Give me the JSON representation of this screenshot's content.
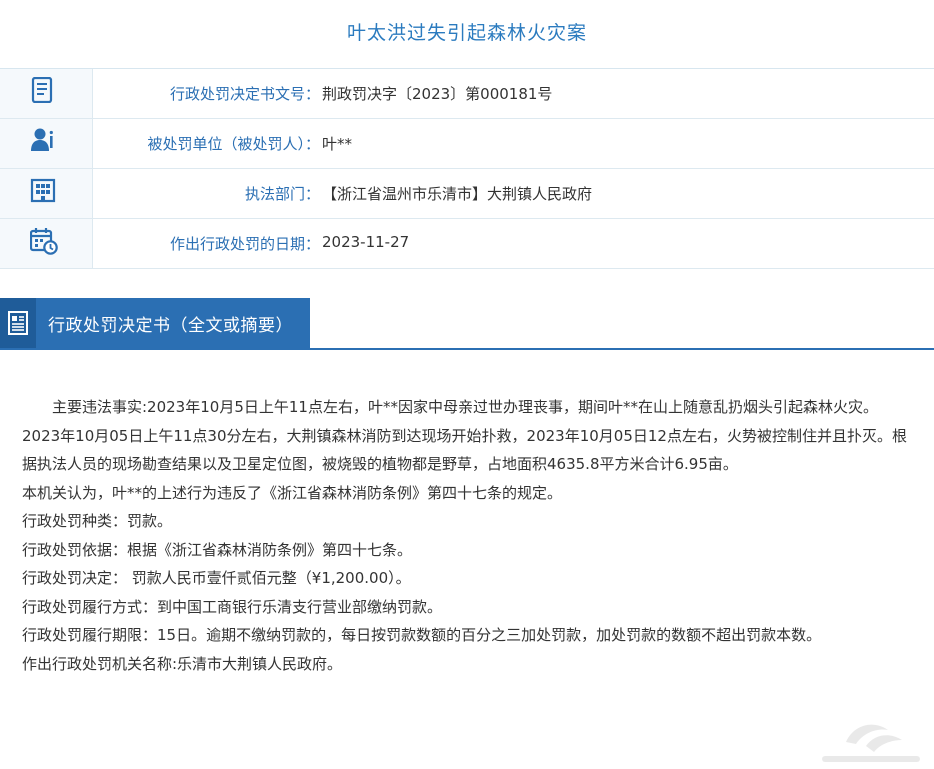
{
  "page_title": "叶太洪过失引起森林火灾案",
  "info_rows": [
    {
      "icon": "document-icon",
      "label": "行政处罚决定书文号：",
      "value": "荆政罚决字〔2023〕第000181号"
    },
    {
      "icon": "person-icon",
      "label": "被处罚单位（被处罚人）：",
      "value": "叶**"
    },
    {
      "icon": "building-icon",
      "label": "执法部门：",
      "value": "【浙江省温州市乐清市】大荆镇人民政府"
    },
    {
      "icon": "calendar-clock-icon",
      "label": "作出行政处罚的日期：",
      "value": "2023-11-27"
    }
  ],
  "section": {
    "icon": "document-list-icon",
    "title": "行政处罚决定书（全文或摘要）"
  },
  "content": {
    "paragraphs": [
      "主要违法事实:2023年10月5日上午11点左右，叶**因家中母亲过世办理丧事，期间叶**在山上随意乱扔烟头引起森林火灾。",
      "2023年10月05日上午11点30分左右，大荆镇森林消防到达现场开始扑救，2023年10月05日12点左右，火势被控制住并且扑灭。根据执法人员的现场勘查结果以及卫星定位图，被烧毁的植物都是野草，占地面积4635.8平方米合计6.95亩。",
      "本机关认为，叶**的上述行为违反了《浙江省森林消防条例》第四十七条的规定。",
      "行政处罚种类：罚款。",
      "行政处罚依据：根据《浙江省森林消防条例》第四十七条。",
      "行政处罚决定： 罚款人民币壹仟贰佰元整（¥1,200.00）。",
      "行政处罚履行方式：到中国工商银行乐清支行营业部缴纳罚款。",
      "行政处罚履行期限：15日。逾期不缴纳罚款的，每日按罚款数额的百分之三加处罚款，加处罚款的数额不超出罚款本数。",
      "作出行政处罚机关名称:乐清市大荆镇人民政府。"
    ]
  },
  "colors": {
    "accent": "#2b6fb3",
    "title": "#2b7bbf",
    "border": "#dde9f0"
  }
}
